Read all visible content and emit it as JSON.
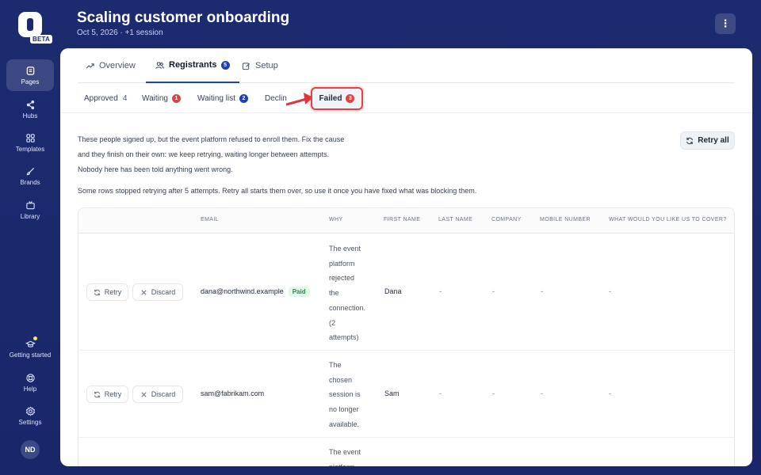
{
  "brand": {
    "beta": "BETA"
  },
  "sidebar": {
    "items": [
      {
        "label": "Pages",
        "icon": "pages-icon"
      },
      {
        "label": "Hubs",
        "icon": "share-icon"
      },
      {
        "label": "Templates",
        "icon": "grid-icon"
      },
      {
        "label": "Brands",
        "icon": "brush-icon"
      },
      {
        "label": "Library",
        "icon": "tv-icon"
      }
    ],
    "bottom": [
      {
        "label": "Getting started",
        "icon": "graduation-cap-icon"
      },
      {
        "label": "Help",
        "icon": "lifebuoy-icon"
      },
      {
        "label": "Settings",
        "icon": "gear-icon"
      }
    ],
    "avatar": "ND"
  },
  "header": {
    "title": "Scaling customer onboarding",
    "subtitle": "Oct 5, 2026 · +1 session",
    "more": "⋮"
  },
  "tabs": [
    {
      "label": "Overview"
    },
    {
      "label": "Registrants",
      "count": "5"
    },
    {
      "label": "Setup"
    }
  ],
  "subtabs": {
    "approved": {
      "label": "Approved",
      "count": "4"
    },
    "waiting": {
      "label": "Waiting",
      "count": "1"
    },
    "waiting_list": {
      "label": "Waiting list",
      "count": "2"
    },
    "declined": {
      "label": "Declin"
    },
    "failed": {
      "label": "Failed",
      "count": "3"
    }
  },
  "description": {
    "line1": "These people signed up, but the event platform refused to enroll them. Fix the cause",
    "line2": "and they finish on their own: we keep retrying, waiting longer between attempts.",
    "line3": "Nobody here has been told anything went wrong.",
    "note": "Some rows stopped retrying after 5 attempts. Retry all starts them over, so use it once you have fixed what was blocking them."
  },
  "retry_all": "Retry all",
  "table": {
    "columns": [
      "Email",
      "Why",
      "First name",
      "Last name",
      "Company",
      "Mobile number",
      "What would you like us to cover?"
    ],
    "actions": {
      "retry": "Retry",
      "discard": "Discard"
    },
    "rows": [
      {
        "email": "dana@northwind.example",
        "badge": "Paid",
        "why": [
          "The event",
          "platform",
          "rejected",
          "the",
          "connection.",
          "(2",
          "attempts)"
        ],
        "first_name": "Dana",
        "last_name": "-",
        "company": "-",
        "mobile": "-",
        "cover": "-"
      },
      {
        "email": "sam@fabrikam.com",
        "why": [
          "The",
          "chosen",
          "session is",
          "no longer",
          "available."
        ],
        "first_name": "Sam",
        "last_name": "-",
        "company": "-",
        "mobile": "-",
        "cover": "-"
      },
      {
        "why": [
          "The event",
          "platform"
        ]
      }
    ]
  }
}
